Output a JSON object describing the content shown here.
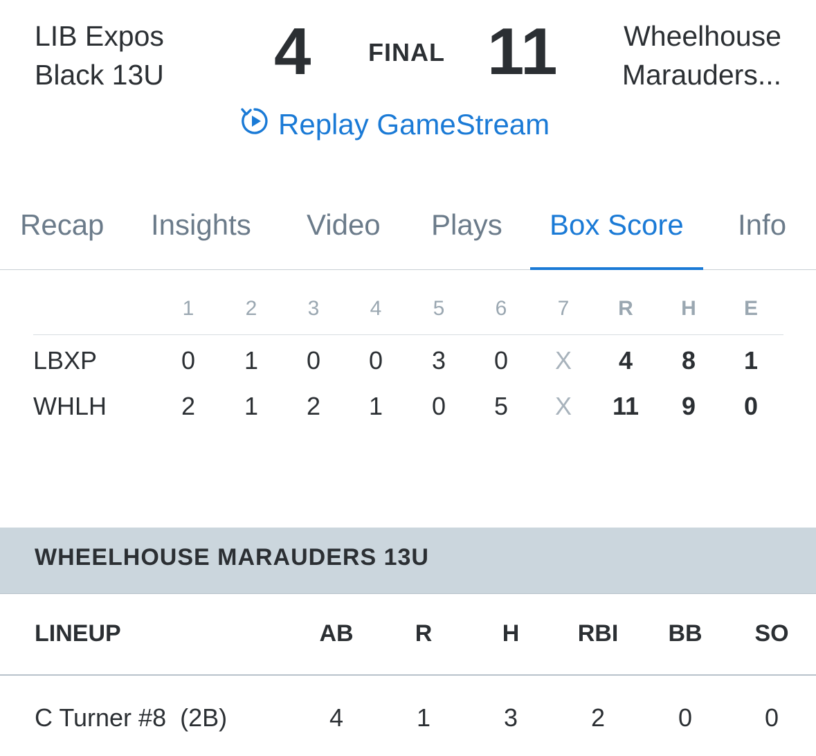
{
  "game": {
    "away_team_line1": "LIB Expos",
    "away_team_line2": "Black 13U",
    "away_score": "4",
    "status": "FINAL",
    "home_score": "11",
    "home_team_line1": "Wheelhouse",
    "home_team_line2": "Marauders...",
    "replay_label": "Replay GameStream",
    "accent_color": "#1a7ad6"
  },
  "tabs": [
    {
      "label": "Recap",
      "active": false
    },
    {
      "label": "Insights",
      "active": false
    },
    {
      "label": "Video",
      "active": false
    },
    {
      "label": "Plays",
      "active": false
    },
    {
      "label": "Box Score",
      "active": true
    },
    {
      "label": "Info",
      "active": false
    }
  ],
  "linescore": {
    "headers": [
      "1",
      "2",
      "3",
      "4",
      "5",
      "6",
      "7",
      "R",
      "H",
      "E"
    ],
    "rows": [
      {
        "team": "LBXP",
        "innings": [
          "0",
          "1",
          "0",
          "0",
          "3",
          "0",
          "X"
        ],
        "R": "4",
        "H": "8",
        "E": "1"
      },
      {
        "team": "WHLH",
        "innings": [
          "2",
          "1",
          "2",
          "1",
          "0",
          "5",
          "X"
        ],
        "R": "11",
        "H": "9",
        "E": "0"
      }
    ]
  },
  "section": {
    "title": "WHEELHOUSE MARAUDERS 13U"
  },
  "lineup": {
    "label": "LINEUP",
    "columns": [
      "AB",
      "R",
      "H",
      "RBI",
      "BB",
      "SO"
    ],
    "players": [
      {
        "name": "C Turner #8  (2B)",
        "stats": [
          "4",
          "1",
          "3",
          "2",
          "0",
          "0"
        ]
      }
    ]
  }
}
